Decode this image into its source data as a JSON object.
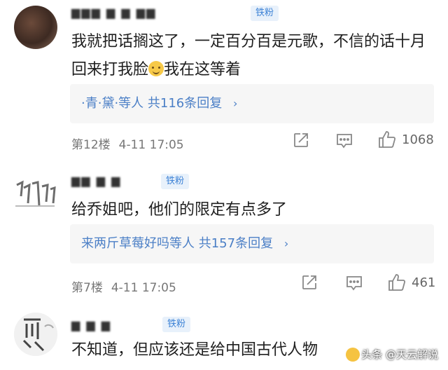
{
  "comments": [
    {
      "username": "▆▆▆ ▆ ▆ ▆▆",
      "badge": "铁粉",
      "text_before_emoji": "我就把话搁这了，一定百分百是元歌，不信的话十月回来打我脸",
      "text_after_emoji": "我在这等着",
      "reply_summary": "·青·黛·等人",
      "reply_count": "共116条回复",
      "floor": "第12楼",
      "date": "4-11 17:05",
      "likes": "1068"
    },
    {
      "username": "▆▆ ▆ ▆",
      "badge": "铁粉",
      "text": "给乔姐吧，他们的限定有点多了",
      "reply_summary": "来两斤草莓好吗等人",
      "reply_count": "共157条回复",
      "floor": "第7楼",
      "date": "4-11 17:05",
      "likes": "461"
    },
    {
      "username": "▆ ▆ ▆",
      "badge": "铁粉",
      "text": "不知道，但应该还是给中国古代人物"
    }
  ],
  "icons": {
    "share": "share-icon",
    "comment": "comment-icon",
    "like": "thumbs-up-icon",
    "chevron": "chevron-right-icon"
  },
  "watermark": {
    "text": "头条 @天云解说"
  },
  "colors": {
    "link": "#4b7fc6",
    "badge_bg": "#e8f1fb",
    "badge_text": "#3e83d6",
    "reply_bg": "#f6f6f6",
    "meta": "#777777"
  }
}
